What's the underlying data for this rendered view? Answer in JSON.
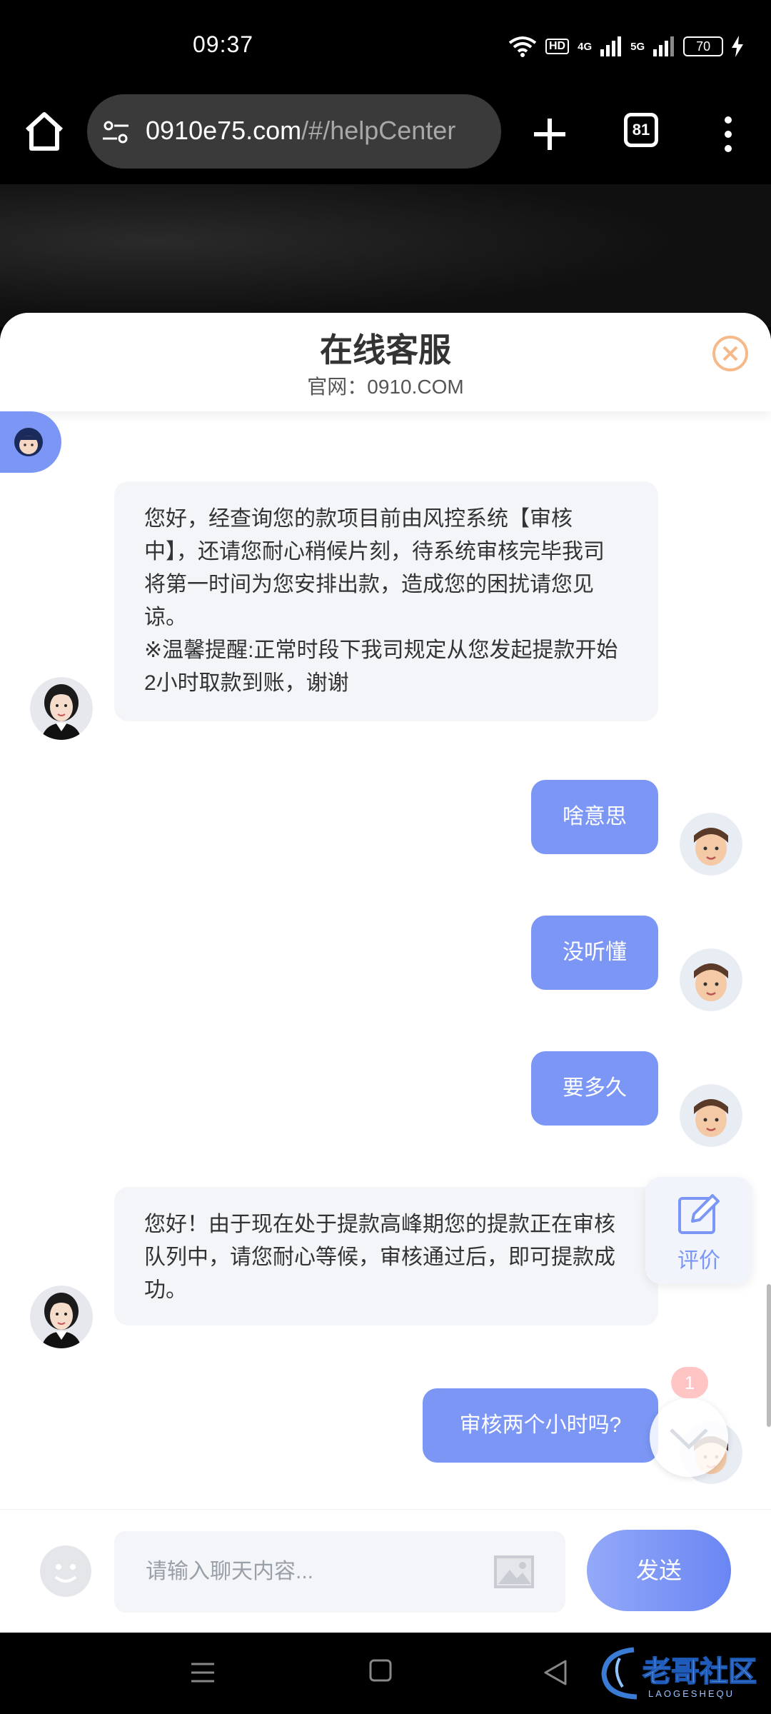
{
  "status_bar": {
    "time": "09:37",
    "hd_label": "HD",
    "network_1": "4G",
    "network_2": "5G",
    "battery": "70"
  },
  "browser": {
    "url_domain": "0910e75.com",
    "url_path": "/#/helpCenter",
    "tab_count": "81",
    "icons": [
      "home-icon",
      "site-settings-icon",
      "plus-icon",
      "menu-icon"
    ]
  },
  "chat": {
    "title": "在线客服",
    "subtitle": "官网：0910.COM",
    "messages": [
      {
        "from": "agent",
        "lines": [
          "您好，经查询您的款项目前由风控系统【审核",
          "中】，还请您耐心稍候片刻，待系统审核完毕我司",
          "将第一时间为您安排出款，造成您的困扰请您见",
          "谅。",
          "※温馨提醒:正常时段下我司规定从您发起提款开始",
          "2小时取款到账，谢谢"
        ]
      },
      {
        "from": "user",
        "text": "啥意思"
      },
      {
        "from": "user",
        "text": "没听懂"
      },
      {
        "from": "user",
        "text": "要多久"
      },
      {
        "from": "agent",
        "lines": [
          "您好！由于现在处于提款高峰期您的提款正在审核",
          "队列中，请您耐心等候，审核通过后，即可提款成",
          "功。"
        ]
      },
      {
        "from": "user",
        "text": "审核两个小时吗?"
      }
    ],
    "rate_label": "评价",
    "unread_count": "1"
  },
  "composer": {
    "placeholder": "请输入聊天内容...",
    "send_label": "发送"
  },
  "watermark": {
    "text": "老哥社区",
    "sub": "LAOGESHEQU"
  },
  "colors": {
    "accent": "#7b96f5",
    "agent_bubble": "#f3f5f9",
    "close_icon": "#f5b98a"
  }
}
